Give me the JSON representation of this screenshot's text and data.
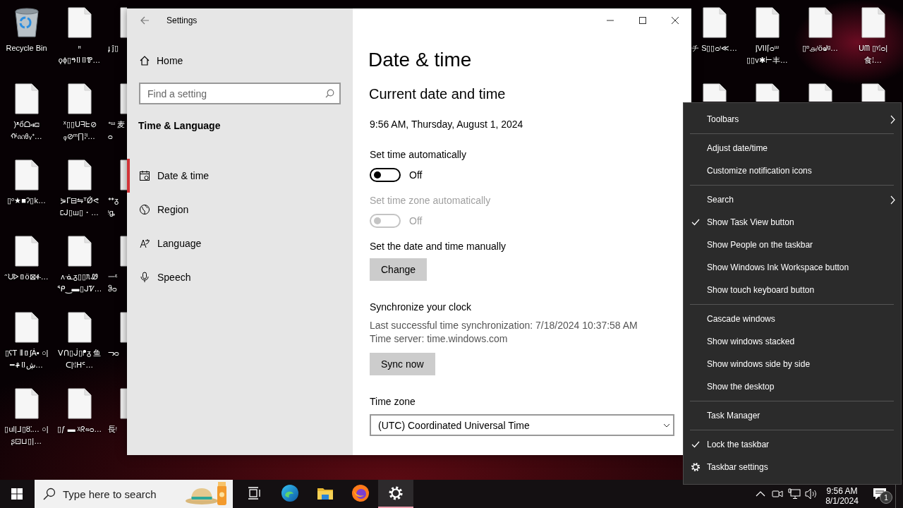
{
  "desktop": {
    "left_columns": [
      [
        {
          "kind": "recycle-bin",
          "label": "Recycle Bin"
        },
        {
          "kind": "file",
          "label": ")ᵜổᗝ⩹⊡ ᡤᦶᦲᵥᕀ…"
        },
        {
          "kind": "file",
          "label": "▯ᵒ★■ʔ▯k…"
        },
        {
          "kind": "file",
          "label": "ᵔᙀᐅ▯ö⊠ፉ…"
        },
        {
          "kind": "file",
          "label": "▯ʕᎢ ⫴▯ʃȦ▪ ○|━ቆ▯ڜ…"
        },
        {
          "kind": "file",
          "label": "▯ul|ᒧ▯ȣ⁚… ○|ʂ⊡⊔▯|…"
        }
      ],
      [
        {
          "kind": "file",
          "label": "ᵸ ϙϕ▯ዓ▯▯Ꮘ…"
        },
        {
          "kind": "file",
          "label": "ᕽ▯▯ᑌᖷᖶ⊘ ᵩ⊘ᵐ∏⁞ᴵ…"
        },
        {
          "kind": "file",
          "label": "⋟ᒥ⊟⇋ᵀǾᕙ ᥴᒍ▯ꟺ▯・…"
        },
        {
          "kind": "file",
          "label": "ʌᓍᵹ▯▯ᥰᏪ ᕿ‿▬▯ᒍᏤ…"
        },
        {
          "kind": "file",
          "label": "ᐯᑎ▯ᒎ▯ᖰᵹ 鱼ᑕ|ᵎ⁞ᕼᑦ…"
        },
        {
          "kind": "file",
          "label": "▯ƒ ▬ ᵡᖇ∾ᴑ…"
        }
      ],
      [
        {
          "kind": "file",
          "label": "ɟ ĵ▯"
        },
        {
          "kind": "file",
          "label": "ᕀᵚ 麦ᴑ"
        },
        {
          "kind": "file",
          "label": "ᕯᵹ ᵎᶃ"
        },
        {
          "kind": "file",
          "label": "ᅳᵋ ჵᴑ"
        },
        {
          "kind": "file",
          "label": "ᓓᴑ"
        },
        {
          "kind": "file",
          "label": "長ᵎ"
        }
      ]
    ],
    "right_columns": [
      [
        {
          "kind": "file",
          "label": "チ S▯▯ᴑᵎ≪…"
        },
        {
          "kind": "file"
        }
      ],
      [
        {
          "kind": "file",
          "label": "ᶅVII⌈ᴑᵚ ▯▯v✱⊢丰…"
        },
        {
          "kind": "file"
        }
      ],
      [
        {
          "kind": "file",
          "label": "▯ᶛ௮ᵎöᖙᵍ…"
        },
        {
          "kind": "file"
        }
      ],
      [
        {
          "kind": "file",
          "label": "ᑌᗰ ▯ᵞ⁞ᴑ|食⁞…"
        },
        {
          "kind": "file"
        }
      ]
    ]
  },
  "settings": {
    "title": "Settings",
    "home": "Home",
    "search_placeholder": "Find a setting",
    "section": "Time & Language",
    "nav": [
      {
        "label": "Date & time",
        "selected": true
      },
      {
        "label": "Region",
        "selected": false
      },
      {
        "label": "Language",
        "selected": false
      },
      {
        "label": "Speech",
        "selected": false
      }
    ],
    "page": {
      "title": "Date & time",
      "heading": "Current date and time",
      "current": "9:56 AM, Thursday, August 1, 2024",
      "rows": [
        {
          "kind": "toggle",
          "label": "Set time automatically",
          "on": false,
          "state_text": "Off",
          "disabled": false
        },
        {
          "kind": "toggle",
          "label": "Set time zone automatically",
          "on": false,
          "state_text": "Off",
          "disabled": true
        },
        {
          "kind": "button",
          "label": "Set the date and time manually",
          "button": "Change"
        },
        {
          "kind": "sync",
          "label": "Synchronize your clock",
          "lines": [
            "Last successful time synchronization: 7/18/2024 10:37:58 AM",
            "Time server: time.windows.com"
          ],
          "button": "Sync now"
        },
        {
          "kind": "dropdown",
          "label": "Time zone",
          "value": "(UTC) Coordinated Universal Time"
        }
      ]
    }
  },
  "context_menu": [
    {
      "kind": "item",
      "label": "Toolbars",
      "checked": false,
      "submenu": true
    },
    {
      "kind": "separator"
    },
    {
      "kind": "item",
      "label": "Adjust date/time",
      "checked": false,
      "submenu": false
    },
    {
      "kind": "item",
      "label": "Customize notification icons",
      "checked": false,
      "submenu": false
    },
    {
      "kind": "separator"
    },
    {
      "kind": "item",
      "label": "Search",
      "checked": false,
      "submenu": true
    },
    {
      "kind": "item",
      "label": "Show Task View button",
      "checked": true,
      "submenu": false
    },
    {
      "kind": "item",
      "label": "Show People on the taskbar",
      "checked": false,
      "submenu": false
    },
    {
      "kind": "item",
      "label": "Show Windows Ink Workspace button",
      "checked": false,
      "submenu": false
    },
    {
      "kind": "item",
      "label": "Show touch keyboard button",
      "checked": false,
      "submenu": false
    },
    {
      "kind": "separator"
    },
    {
      "kind": "item",
      "label": "Cascade windows",
      "checked": false,
      "submenu": false
    },
    {
      "kind": "item",
      "label": "Show windows stacked",
      "checked": false,
      "submenu": false
    },
    {
      "kind": "item",
      "label": "Show windows side by side",
      "checked": false,
      "submenu": false
    },
    {
      "kind": "item",
      "label": "Show the desktop",
      "checked": false,
      "submenu": false
    },
    {
      "kind": "separator"
    },
    {
      "kind": "item",
      "label": "Task Manager",
      "checked": false,
      "submenu": false
    },
    {
      "kind": "separator"
    },
    {
      "kind": "item",
      "label": "Lock the taskbar",
      "checked": true,
      "submenu": false
    },
    {
      "kind": "settings",
      "label": "Taskbar settings",
      "checked": false,
      "submenu": false
    }
  ],
  "taskbar": {
    "search_placeholder": "Type here to search",
    "apps": [
      {
        "active": false
      },
      {
        "active": false
      },
      {
        "active": false
      },
      {
        "active": false
      },
      {
        "active": true
      }
    ],
    "time": "9:56 AM",
    "date": "8/1/2024",
    "notification_count": "1"
  }
}
